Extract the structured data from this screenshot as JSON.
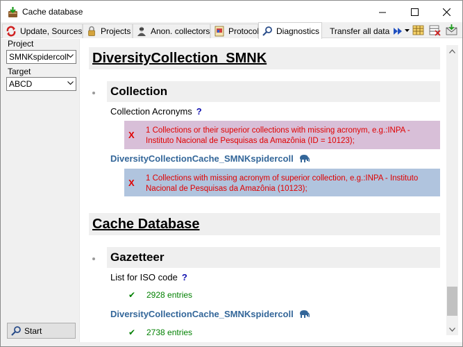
{
  "window": {
    "title": "Cache database"
  },
  "tabs": [
    {
      "label": "Update, Sources",
      "icon": "update-sources-icon"
    },
    {
      "label": "Projects",
      "icon": "lock-icon"
    },
    {
      "label": "Anon. collectors",
      "icon": "anonymous-person-icon"
    },
    {
      "label": "Protocol",
      "icon": "protocol-icon"
    },
    {
      "label": "Diagnostics",
      "icon": "magnifier-icon",
      "active": true
    },
    {
      "label": "Transfer all data",
      "icon": "fast-forward-icon"
    }
  ],
  "left": {
    "project_label": "Project",
    "project_value": "SMNKspidercoll",
    "target_label": "Target",
    "target_value": "ABCD",
    "start_label": "Start"
  },
  "sections": {
    "section1_title": "DiversityCollection_SMNK",
    "collection_title": "Collection",
    "acronyms_label": "Collection Acronyms",
    "qmark": "?",
    "error1_x": "X",
    "error1_text": "1 Collections or their superior collections with missing acronym, e.g.:INPA - Instituto Nacional de Pesquisas da Amazônia (ID = 10123);",
    "cache_db_name_1": "DiversityCollectionCache_SMNKspidercoll",
    "error2_x": "X",
    "error2_text": "1 Collections with missing acronym of superior collection, e.g.:INPA - Instituto Nacional de Pesquisas da Amazônia (10123);",
    "section2_title": "Cache Database",
    "gazetteer_title": "Gazetteer",
    "iso_label": "List for ISO code",
    "iso_entries": "2928 entries",
    "cache_db_name_2": "DiversityCollectionCache_SMNKspidercoll",
    "cache_entries": "2738 entries",
    "check": "✔"
  },
  "colors": {
    "error_pink": "#d8bfd8",
    "error_blue": "#b0c4de",
    "error_text": "#e00000",
    "ok_text": "#008000",
    "link": "#336699"
  }
}
